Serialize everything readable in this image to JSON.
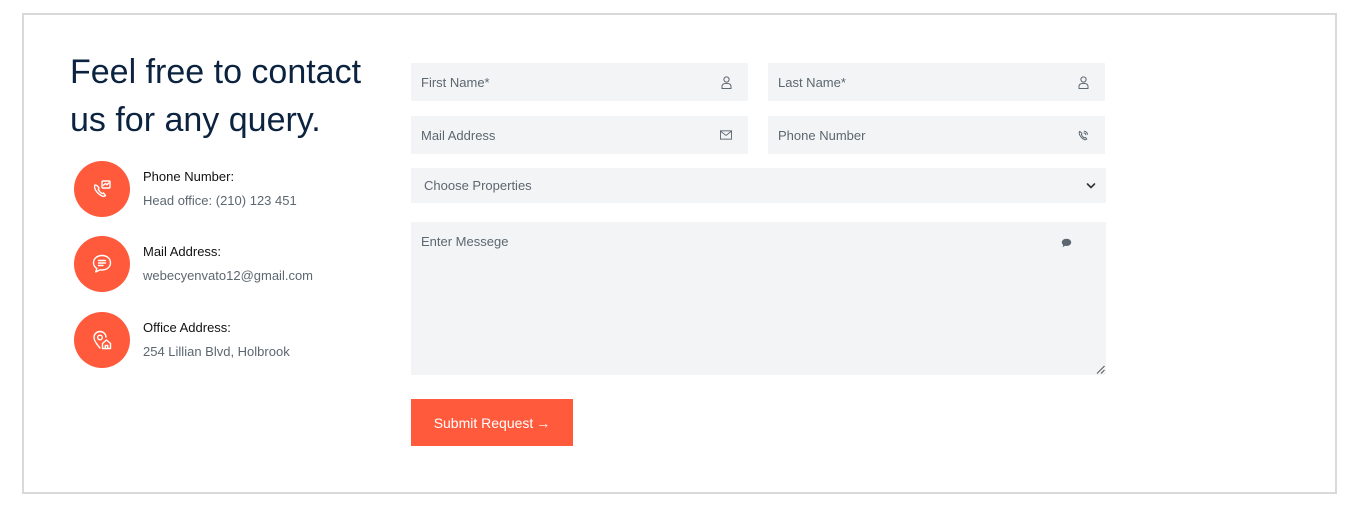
{
  "heading": "Feel free to contact us for any query.",
  "contact_items": [
    {
      "icon": "phone-icon",
      "title": "Phone Number:",
      "value": "Head office: (210) 123 451"
    },
    {
      "icon": "chat-mail-icon",
      "title": "Mail Address:",
      "value": "webecyenvato12@gmail.com"
    },
    {
      "icon": "location-home-icon",
      "title": "Office Address:",
      "value": "254 Lillian Blvd, Holbrook"
    }
  ],
  "form": {
    "first_name_placeholder": "First Name*",
    "last_name_placeholder": "Last Name*",
    "mail_placeholder": "Mail Address",
    "phone_placeholder": "Phone Number",
    "select_value": "Choose Properties",
    "message_placeholder": "Enter Messege",
    "submit_label": "Submit Request",
    "submit_arrow": "→"
  },
  "colors": {
    "accent": "#ff5a3c",
    "heading": "#0c2340",
    "field_bg": "#f3f4f6",
    "muted_text": "#5c6770"
  }
}
